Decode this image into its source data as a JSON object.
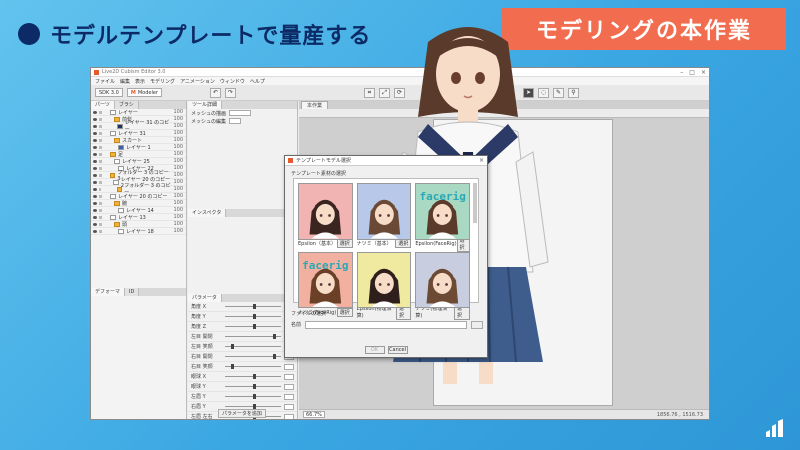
{
  "slide": {
    "title": "モデルテンプレートで量産する",
    "badge": "モデリングの本作業",
    "colors": {
      "title": "#0c2a66",
      "badge_bg": "#f26c4f",
      "background": "#3aa6e2"
    }
  },
  "app": {
    "window_title": "Live2D Cubism Editor 3.0",
    "menus": [
      "ファイル",
      "編集",
      "表示",
      "モデリング",
      "アニメーション",
      "ウィンドウ",
      "ヘルプ"
    ],
    "toolbar": {
      "sdk_select": "SDK 3.0",
      "mode_select": "Modeler"
    },
    "left_panel": {
      "tabs": [
        "パーツ",
        "ブラシ"
      ],
      "layers": [
        {
          "name": "レイヤー",
          "pct": "100",
          "kind": "plain"
        },
        {
          "name": "前髪",
          "pct": "100",
          "kind": "folder"
        },
        {
          "name": "レイヤー 31 のコピー",
          "pct": "100",
          "kind": "dark"
        },
        {
          "name": "レイヤー 31",
          "pct": "100",
          "kind": "plain"
        },
        {
          "name": "スカート",
          "pct": "100",
          "kind": "folder"
        },
        {
          "name": "レイヤー 1",
          "pct": "100",
          "kind": "blue"
        },
        {
          "name": "足",
          "pct": "100",
          "kind": "folder"
        },
        {
          "name": "レイヤー 25",
          "pct": "100",
          "kind": "plain"
        },
        {
          "name": "レイヤー 22",
          "pct": "100",
          "kind": "plain"
        },
        {
          "name": "フォルダー 3 のコピー 3",
          "pct": "100",
          "kind": "folder"
        },
        {
          "name": "レイヤー 20 のコピー 2",
          "pct": "100",
          "kind": "plain"
        },
        {
          "name": "フォルダー 3 のコピー",
          "pct": "100",
          "kind": "folder"
        },
        {
          "name": "レイヤー 20 のコピー",
          "pct": "100",
          "kind": "plain"
        },
        {
          "name": "腕",
          "pct": "100",
          "kind": "folder"
        },
        {
          "name": "レイヤー 14",
          "pct": "100",
          "kind": "plain"
        },
        {
          "name": "レイヤー 13",
          "pct": "100",
          "kind": "plain"
        },
        {
          "name": "頭",
          "pct": "100",
          "kind": "folder"
        },
        {
          "name": "レイヤー 18",
          "pct": "100",
          "kind": "plain"
        }
      ],
      "deformer_tabs": [
        "デフォーマ",
        "ID"
      ]
    },
    "mid_panel": {
      "header": "ツール詳細",
      "prop_labels": [
        "メッシュの描画",
        "メッシュの編集"
      ],
      "section2": "インスペクタ",
      "param_header": "パラメータ",
      "params": [
        {
          "name": "角度 X",
          "pos": 0.5
        },
        {
          "name": "角度 Y",
          "pos": 0.5
        },
        {
          "name": "角度 Z",
          "pos": 0.5
        },
        {
          "name": "左目 開閉",
          "pos": 0.85
        },
        {
          "name": "左目 笑顔",
          "pos": 0.1
        },
        {
          "name": "右目 開閉",
          "pos": 0.85
        },
        {
          "name": "右目 笑顔",
          "pos": 0.1
        },
        {
          "name": "眼球 X",
          "pos": 0.5
        },
        {
          "name": "眼球 Y",
          "pos": 0.5
        },
        {
          "name": "左眉 Y",
          "pos": 0.5
        },
        {
          "name": "右眉 Y",
          "pos": 0.5
        },
        {
          "name": "左眉 左右",
          "pos": 0.5
        }
      ],
      "bottom_button": "パラメータを追加"
    },
    "canvas": {
      "doc_tab": "本作業",
      "zoom": "66.7%",
      "coords": "1856.76 , 1516.73"
    }
  },
  "dialog": {
    "title": "テンプレートモデル選択",
    "group_label": "テンプレート素材の選択",
    "templates": [
      {
        "caption": "Epsilon（基本）",
        "facerig": "",
        "bg": "#f2b3b3",
        "hair": "#3a2520"
      },
      {
        "caption": "ナツミ（基本）",
        "facerig": "",
        "bg": "#b8c8e8",
        "hair": "#6a4a36"
      },
      {
        "caption": "Epsilon(FaceRig)",
        "facerig": "facerig",
        "bg": "#a9d9c2",
        "hair": "#5a3a2a"
      },
      {
        "caption": "ナツミ(FaceRig)",
        "facerig": "facerig",
        "bg": "#f2b0a0",
        "hair": "#6a4026"
      },
      {
        "caption": "Epsilon(物理演算)",
        "facerig": "",
        "bg": "#f0e9a0",
        "hair": "#2e1f1c"
      },
      {
        "caption": "ナツミ(物理演算)",
        "facerig": "",
        "bg": "#c8cde0",
        "hair": "#6c4a34"
      }
    ],
    "select_label": "選択",
    "file_label": "ファイルの選択",
    "name_label": "名前",
    "ok_label": "OK",
    "cancel_label": "Cancel"
  }
}
